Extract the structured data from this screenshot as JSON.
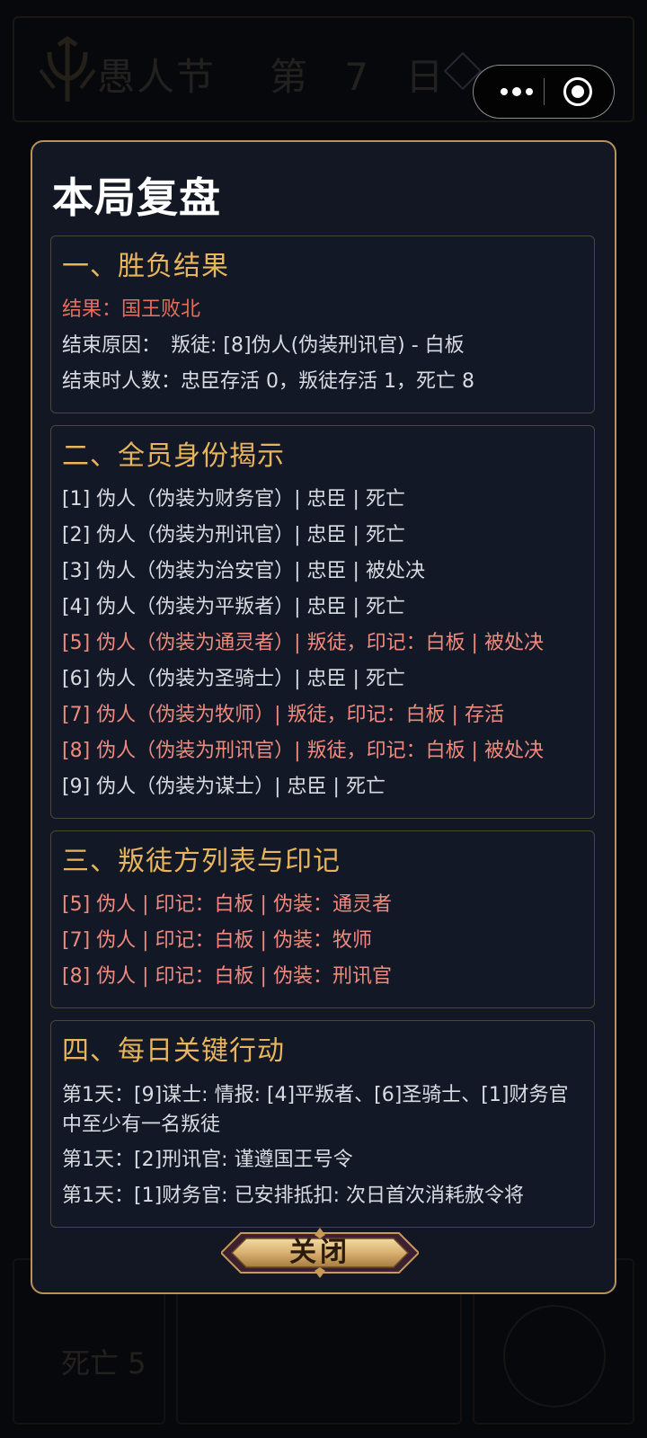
{
  "background": {
    "title": "愚人节",
    "day": "第 7 日",
    "dead_label": "死亡 5"
  },
  "capsule": {
    "menu_icon": "more-dots-icon",
    "close_icon": "target-close-icon"
  },
  "modal": {
    "title": "本局复盘",
    "sections": [
      {
        "heading": "一、胜负结果",
        "lines": [
          {
            "text": "结果：国王败北",
            "tone": "red"
          },
          {
            "text": "结束原因：　叛徒: [8]伪人(伪装刑讯官) - 白板",
            "tone": "normal"
          },
          {
            "text": "结束时人数：忠臣存活 0，叛徒存活 1，死亡 8",
            "tone": "normal"
          }
        ]
      },
      {
        "heading": "二、全员身份揭示",
        "lines": [
          {
            "text": "[1] 伪人（伪装为财务官）| 忠臣 | 死亡",
            "tone": "normal"
          },
          {
            "text": "[2] 伪人（伪装为刑讯官）| 忠臣 | 死亡",
            "tone": "normal"
          },
          {
            "text": "[3] 伪人（伪装为治安官）| 忠臣 | 被处决",
            "tone": "normal"
          },
          {
            "text": "[4] 伪人（伪装为平叛者）| 忠臣 | 死亡",
            "tone": "normal"
          },
          {
            "text": "[5] 伪人（伪装为通灵者）| 叛徒，印记：白板 | 被处决",
            "tone": "pink"
          },
          {
            "text": "[6] 伪人（伪装为圣骑士）| 忠臣 | 死亡",
            "tone": "normal"
          },
          {
            "text": "[7] 伪人（伪装为牧师）| 叛徒，印记：白板 | 存活",
            "tone": "pink"
          },
          {
            "text": "[8] 伪人（伪装为刑讯官）| 叛徒，印记：白板 | 被处决",
            "tone": "pink"
          },
          {
            "text": "[9] 伪人（伪装为谋士）| 忠臣 | 死亡",
            "tone": "normal"
          }
        ]
      },
      {
        "heading": "三、叛徒方列表与印记",
        "lines": [
          {
            "text": "[5] 伪人 | 印记：白板 | 伪装：通灵者",
            "tone": "pink"
          },
          {
            "text": "[7] 伪人 | 印记：白板 | 伪装：牧师",
            "tone": "pink"
          },
          {
            "text": "[8] 伪人 | 印记：白板 | 伪装：刑讯官",
            "tone": "pink"
          }
        ]
      },
      {
        "heading": "四、每日关键行动",
        "lines": [
          {
            "text": "第1天：[9]谋士: 情报: [4]平叛者、[6]圣骑士、[1]财务官 中至少有一名叛徒",
            "tone": "normal"
          },
          {
            "text": "第1天：[2]刑讯官: 谨遵国王号令",
            "tone": "normal"
          },
          {
            "text": "第1天：[1]财务官: 已安排抵扣: 次日首次消耗赦令将",
            "tone": "normal"
          }
        ]
      }
    ],
    "close_label": "关闭"
  },
  "colors": {
    "modal_bg": "#121723",
    "modal_border": "#b8925a",
    "heading": "#e8b55c",
    "result_red": "#e86d5d",
    "traitor_pink": "#f08a7e",
    "body_text": "#d9dbe2"
  }
}
